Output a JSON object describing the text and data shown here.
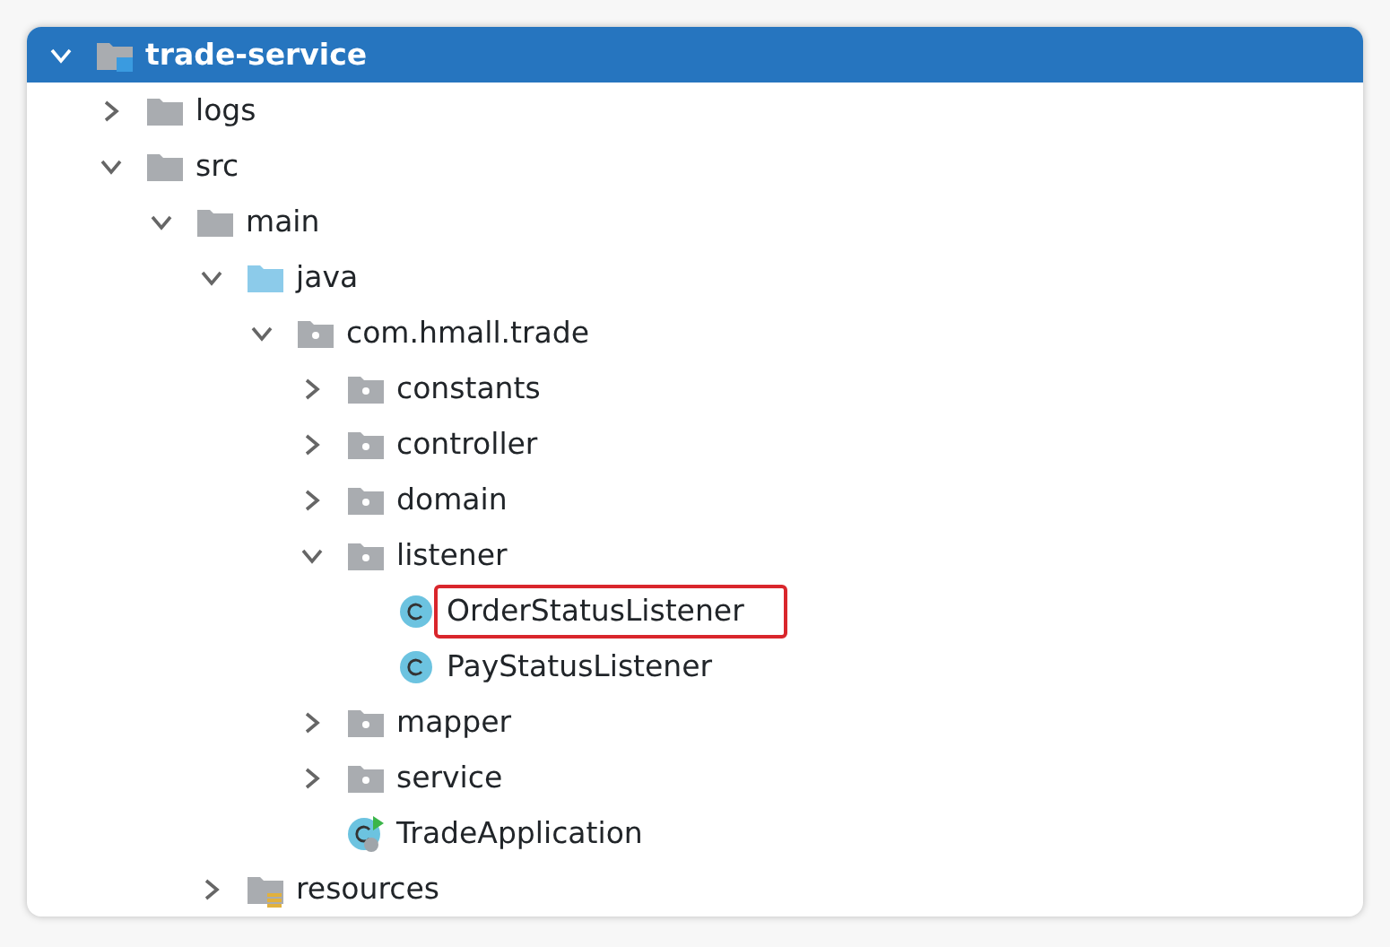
{
  "project_tree": {
    "nodes": [
      {
        "name": "trade-service",
        "kind": "module",
        "expanded": true,
        "selected": true,
        "marked": false,
        "children": [
          {
            "name": "logs",
            "kind": "folder",
            "expanded": false,
            "selected": false,
            "marked": false
          },
          {
            "name": "src",
            "kind": "folder",
            "expanded": true,
            "selected": false,
            "marked": false,
            "children": [
              {
                "name": "main",
                "kind": "folder",
                "expanded": true,
                "selected": false,
                "marked": false,
                "children": [
                  {
                    "name": "java",
                    "kind": "source",
                    "expanded": true,
                    "selected": false,
                    "marked": false,
                    "children": [
                      {
                        "name": "com.hmall.trade",
                        "kind": "package",
                        "expanded": true,
                        "selected": false,
                        "marked": false,
                        "children": [
                          {
                            "name": "constants",
                            "kind": "package",
                            "expanded": false,
                            "selected": false,
                            "marked": false
                          },
                          {
                            "name": "controller",
                            "kind": "package",
                            "expanded": false,
                            "selected": false,
                            "marked": false
                          },
                          {
                            "name": "domain",
                            "kind": "package",
                            "expanded": false,
                            "selected": false,
                            "marked": false
                          },
                          {
                            "name": "listener",
                            "kind": "package",
                            "expanded": true,
                            "selected": false,
                            "marked": false,
                            "children": [
                              {
                                "name": "OrderStatusListener",
                                "kind": "class",
                                "selected": false,
                                "marked": true
                              },
                              {
                                "name": "PayStatusListener",
                                "kind": "class",
                                "selected": false,
                                "marked": false
                              }
                            ]
                          },
                          {
                            "name": "mapper",
                            "kind": "package",
                            "expanded": false,
                            "selected": false,
                            "marked": false
                          },
                          {
                            "name": "service",
                            "kind": "package",
                            "expanded": false,
                            "selected": false,
                            "marked": false
                          },
                          {
                            "name": "TradeApplication",
                            "kind": "main-class",
                            "selected": false,
                            "marked": false
                          }
                        ]
                      }
                    ]
                  },
                  {
                    "name": "resources",
                    "kind": "resources",
                    "expanded": false,
                    "selected": false,
                    "marked": false
                  }
                ]
              }
            ]
          }
        ]
      }
    ]
  }
}
